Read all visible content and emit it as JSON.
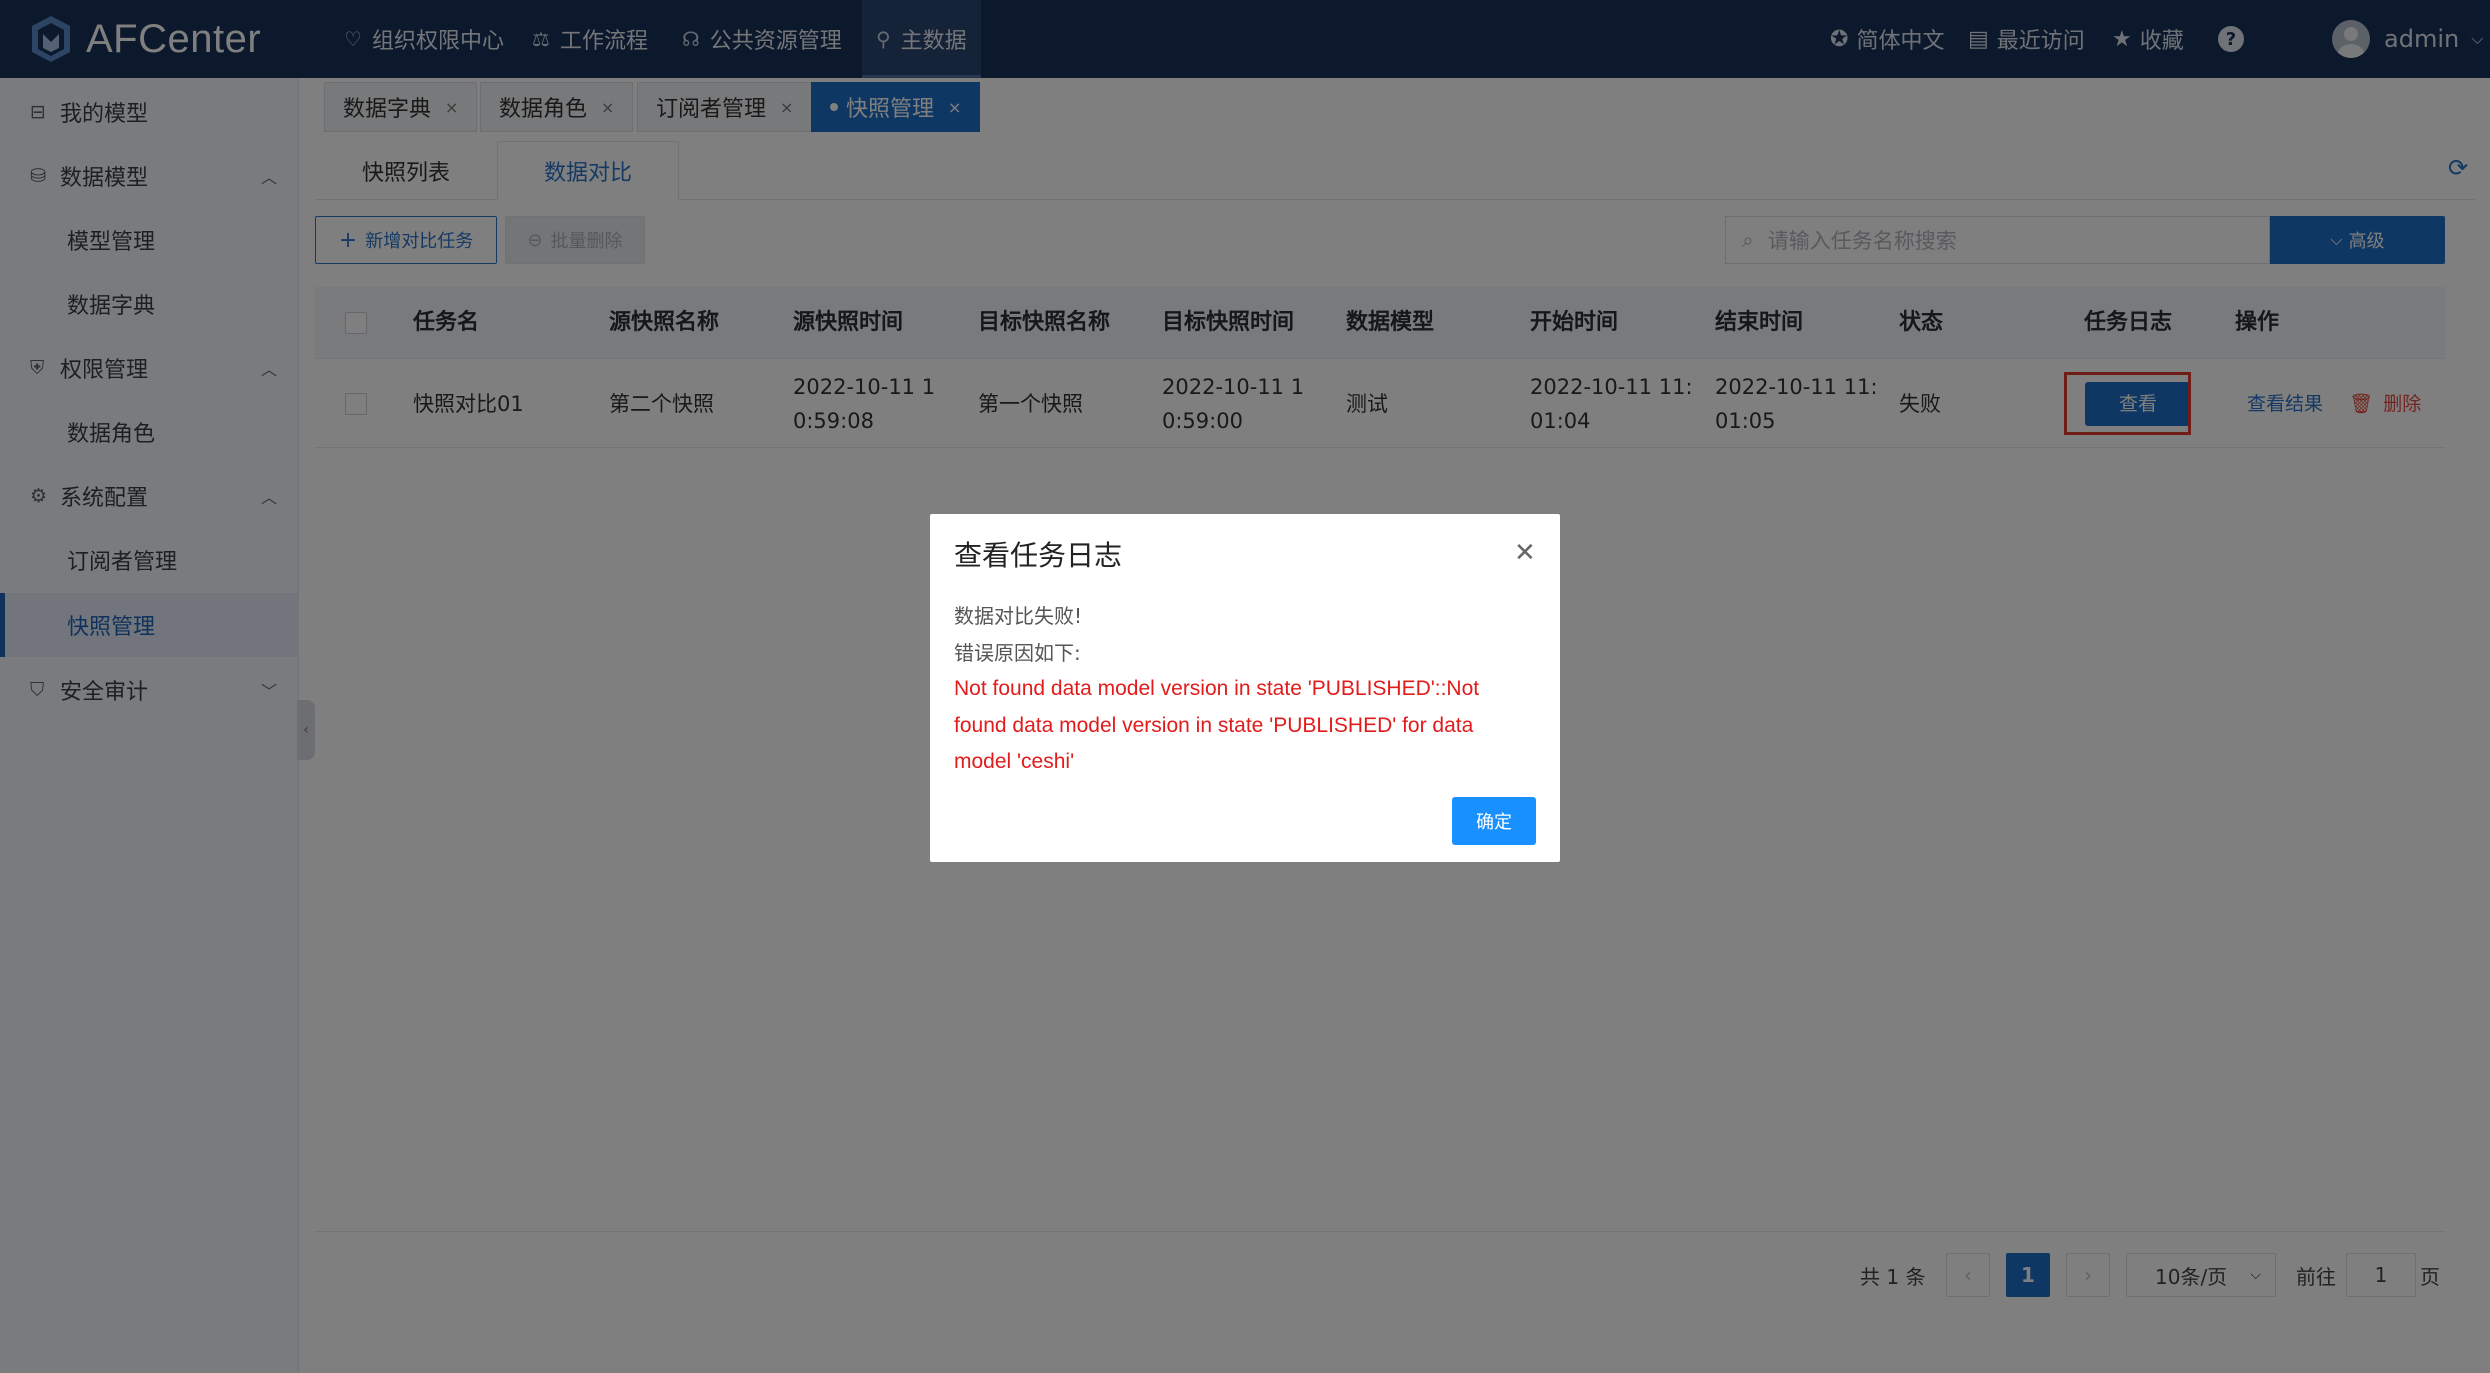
{
  "header": {
    "brand": "AFCenter",
    "nav": [
      {
        "label": "组织权限中心"
      },
      {
        "label": "工作流程"
      },
      {
        "label": "公共资源管理"
      },
      {
        "label": "主数据"
      }
    ],
    "language": "简体中文",
    "recent": "最近访问",
    "favorites": "收藏",
    "help": "?",
    "user": "admin"
  },
  "sidebar": {
    "items": [
      {
        "label": "我的模型"
      },
      {
        "label": "数据模型"
      },
      {
        "label": "模型管理"
      },
      {
        "label": "数据字典"
      },
      {
        "label": "权限管理"
      },
      {
        "label": "数据角色"
      },
      {
        "label": "系统配置"
      },
      {
        "label": "订阅者管理"
      },
      {
        "label": "快照管理"
      },
      {
        "label": "安全审计"
      }
    ]
  },
  "page_tabs": [
    {
      "label": "数据字典"
    },
    {
      "label": "数据角色"
    },
    {
      "label": "订阅者管理"
    },
    {
      "label": "快照管理"
    }
  ],
  "sub_tabs": [
    {
      "label": "快照列表"
    },
    {
      "label": "数据对比"
    }
  ],
  "toolbar": {
    "add_label": "新增对比任务",
    "batch_delete_label": "批量删除",
    "search_placeholder": "请输入任务名称搜索",
    "advanced_label": "高级"
  },
  "table": {
    "columns": [
      "任务名",
      "源快照名称",
      "源快照时间",
      "目标快照名称",
      "目标快照时间",
      "数据模型",
      "开始时间",
      "结束时间",
      "状态",
      "任务日志",
      "操作"
    ],
    "rows": [
      {
        "task_name": "快照对比01",
        "source_name": "第二个快照",
        "source_time_1": "2022-10-11 1",
        "source_time_2": "0:59:08",
        "target_name": "第一个快照",
        "target_time_1": "2022-10-11 1",
        "target_time_2": "0:59:00",
        "model": "测试",
        "start_1": "2022-10-11 11:",
        "start_2": "01:04",
        "end_1": "2022-10-11 11:",
        "end_2": "01:05",
        "status": "失败",
        "log_button": "查看",
        "view_result": "查看结果",
        "delete": "删除"
      }
    ]
  },
  "pagination": {
    "total": "共 1 条",
    "current_page": "1",
    "page_size": "10条/页",
    "goto_label": "前往",
    "goto_value": "1",
    "page_suffix": "页"
  },
  "modal": {
    "title": "查看任务日志",
    "line1": "数据对比失败!",
    "line2": "错误原因如下:",
    "error_1": "Not found data model version in state 'PUBLISHED'::Not",
    "error_2": "found data model version in state 'PUBLISHED' for data",
    "error_3": "model 'ceshi'",
    "ok_label": "确定"
  },
  "colors": {
    "header_bg": "#19325a",
    "primary": "#1f6fc7",
    "danger": "#e21b1b",
    "highlight_outline": "#e23a2e"
  }
}
